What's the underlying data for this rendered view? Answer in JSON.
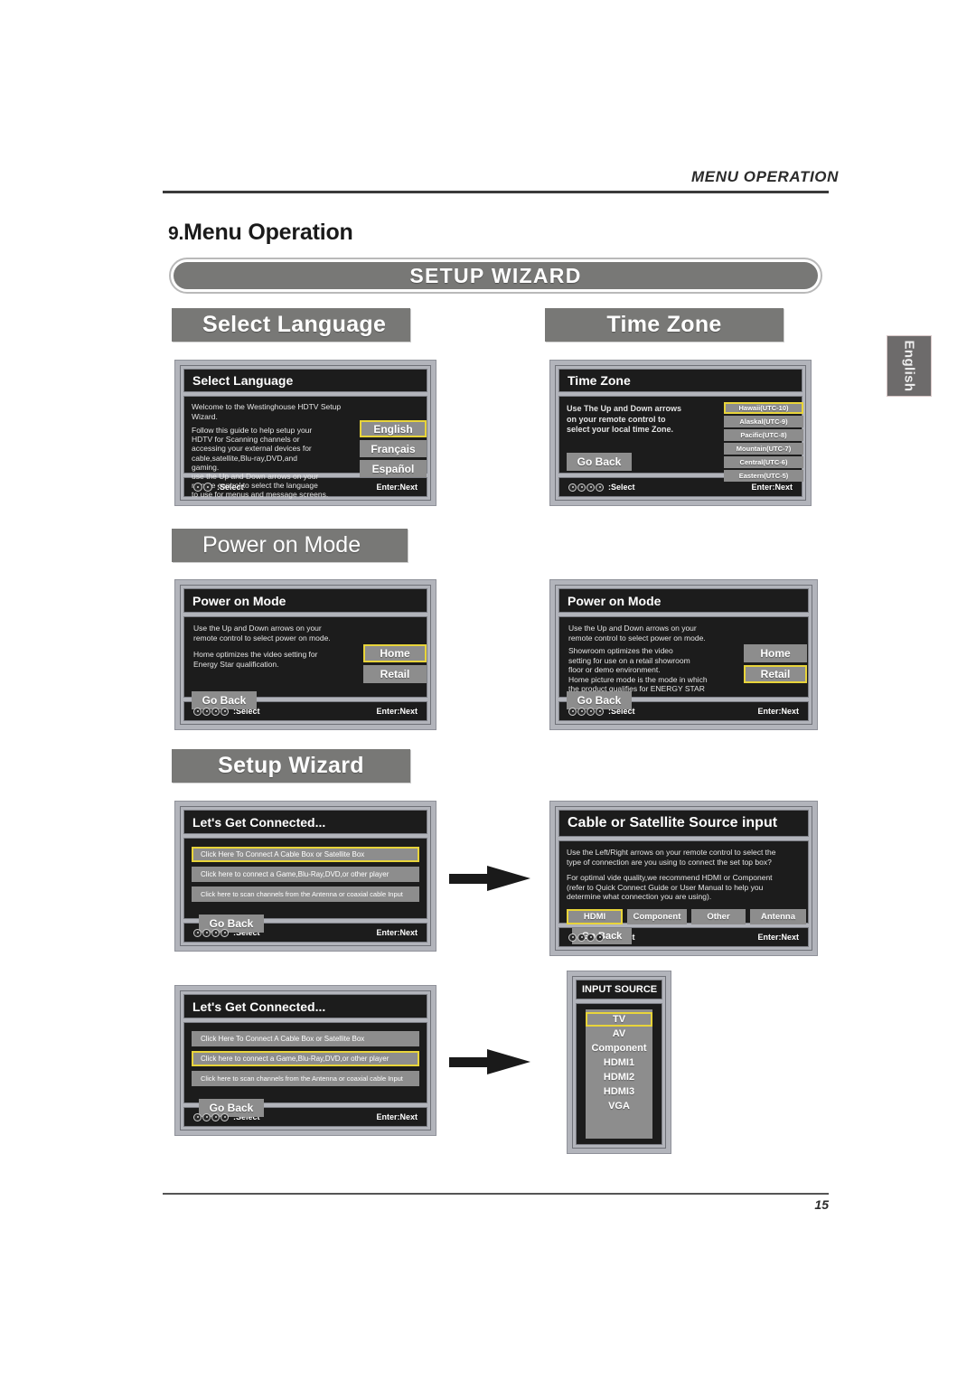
{
  "running_head": "MENU OPERATION",
  "page_number": "15",
  "chapter": {
    "number": "9.",
    "title": "Menu Operation"
  },
  "banner": "SETUP WIZARD",
  "language_tab": "English",
  "sections": {
    "select_language": "Select  Language",
    "time_zone": "Time Zone",
    "power_on_mode": "Power on Mode",
    "setup_wizard": "Setup Wizard"
  },
  "footer": {
    "select": ":Select",
    "next": "Enter:Next"
  },
  "screens": {
    "select_language": {
      "title": "Select Language",
      "intro": "Welcome to the Westinghouse HDTV Setup Wizard.",
      "body_lines": [
        "Follow this guide to help setup your",
        "HDTV for Scanning channels or",
        "accessing your external devices for",
        "cable,satellite,Blu-ray,DVD,and",
        "gaming.",
        "use the Up and Down arrows on your",
        "remote control to select the language",
        "to use for menus and message screens."
      ],
      "options": [
        "English",
        "Français",
        "Español"
      ],
      "selected": "English",
      "glyph_count": 2
    },
    "time_zone": {
      "title": "Time Zone",
      "body_lines": [
        "Use The Up and Down arrows",
        "on your remote control to",
        "select your local time Zone."
      ],
      "options": [
        "Hawaii(UTC-10)",
        "Alaskal(UTC-9)",
        "Pacific(UTC-8)",
        "Mountain(UTC-7)",
        "Central(UTC-6)",
        "Eastern(UTC-5)"
      ],
      "selected": "Hawaii(UTC-10)",
      "go_back": "Go Back",
      "glyph_count": 4
    },
    "power_on_mode_home": {
      "title": "Power on Mode",
      "body_lines": [
        "Use the Up and Down arrows on your",
        "remote control to select power on mode.",
        "",
        "Home optimizes the video setting for",
        "Energy Star qualification."
      ],
      "options": [
        "Home",
        "Retail"
      ],
      "selected": "Home",
      "go_back": "Go Back",
      "glyph_count": 4
    },
    "power_on_mode_retail": {
      "title": "Power on Mode",
      "body_lines": [
        "Use the Up and Down arrows on your",
        "remote control to select power on mode.",
        "Showroom optimizes the video",
        "setting for use on a retail showroom",
        "floor or demo environment.",
        "Home picture mode is the mode in which",
        "the product qualifies for ENERGY STAR"
      ],
      "options": [
        "Home",
        "Retail"
      ],
      "selected": "Retail",
      "go_back": "Go Back",
      "glyph_count": 4
    },
    "lets_get_connected_1": {
      "title": "Let's Get Connected...",
      "options": [
        "Click Here To Connect A Cable Box or  Satellite Box",
        "Click here to connect a Game,Blu-Ray,DVD,or other player",
        "Click here to scan channels from the Antenna or coaxial cable Input"
      ],
      "selected_index": 0,
      "go_back": "Go Back",
      "glyph_count": 4
    },
    "lets_get_connected_2": {
      "title": "Let's Get Connected...",
      "options": [
        "Click Here To Connect A Cable Box or  Satellite Box",
        "Click here to connect a Game,Blu-Ray,DVD,or other player",
        "Click here to scan channels from the Antenna or coaxial cable Input"
      ],
      "selected_index": 1,
      "go_back": "Go Back",
      "glyph_count": 4
    },
    "cable_or_satellite": {
      "title": "Cable or Satellite Source input",
      "body_lines": [
        "Use the Left/Right arrows on your remote control to select the",
        "type of connection are you using to connect the set top box?",
        "",
        "For optimal vide quality,we recommend HDMI or Component",
        "(refer to Quick Connect Guide or User Manual to help you",
        "determine what connection you are using)."
      ],
      "options": [
        "HDMI",
        "Component",
        "Other",
        "Antenna"
      ],
      "selected": "HDMI",
      "go_back": "Go Back",
      "glyph_count": 4
    },
    "input_source": {
      "title": "INPUT SOURCE",
      "options": [
        "TV",
        "AV",
        "Component",
        "HDMI1",
        "HDMI2",
        "HDMI3",
        "VGA"
      ],
      "selected": "TV"
    }
  },
  "colors": {
    "bar_gray": "#787876",
    "osd_bezel": "#b2b4bb",
    "osd_bg": "#1c1c1c",
    "button_gray": "#8d8d8d",
    "highlight_yellow": "#e8d43a"
  }
}
